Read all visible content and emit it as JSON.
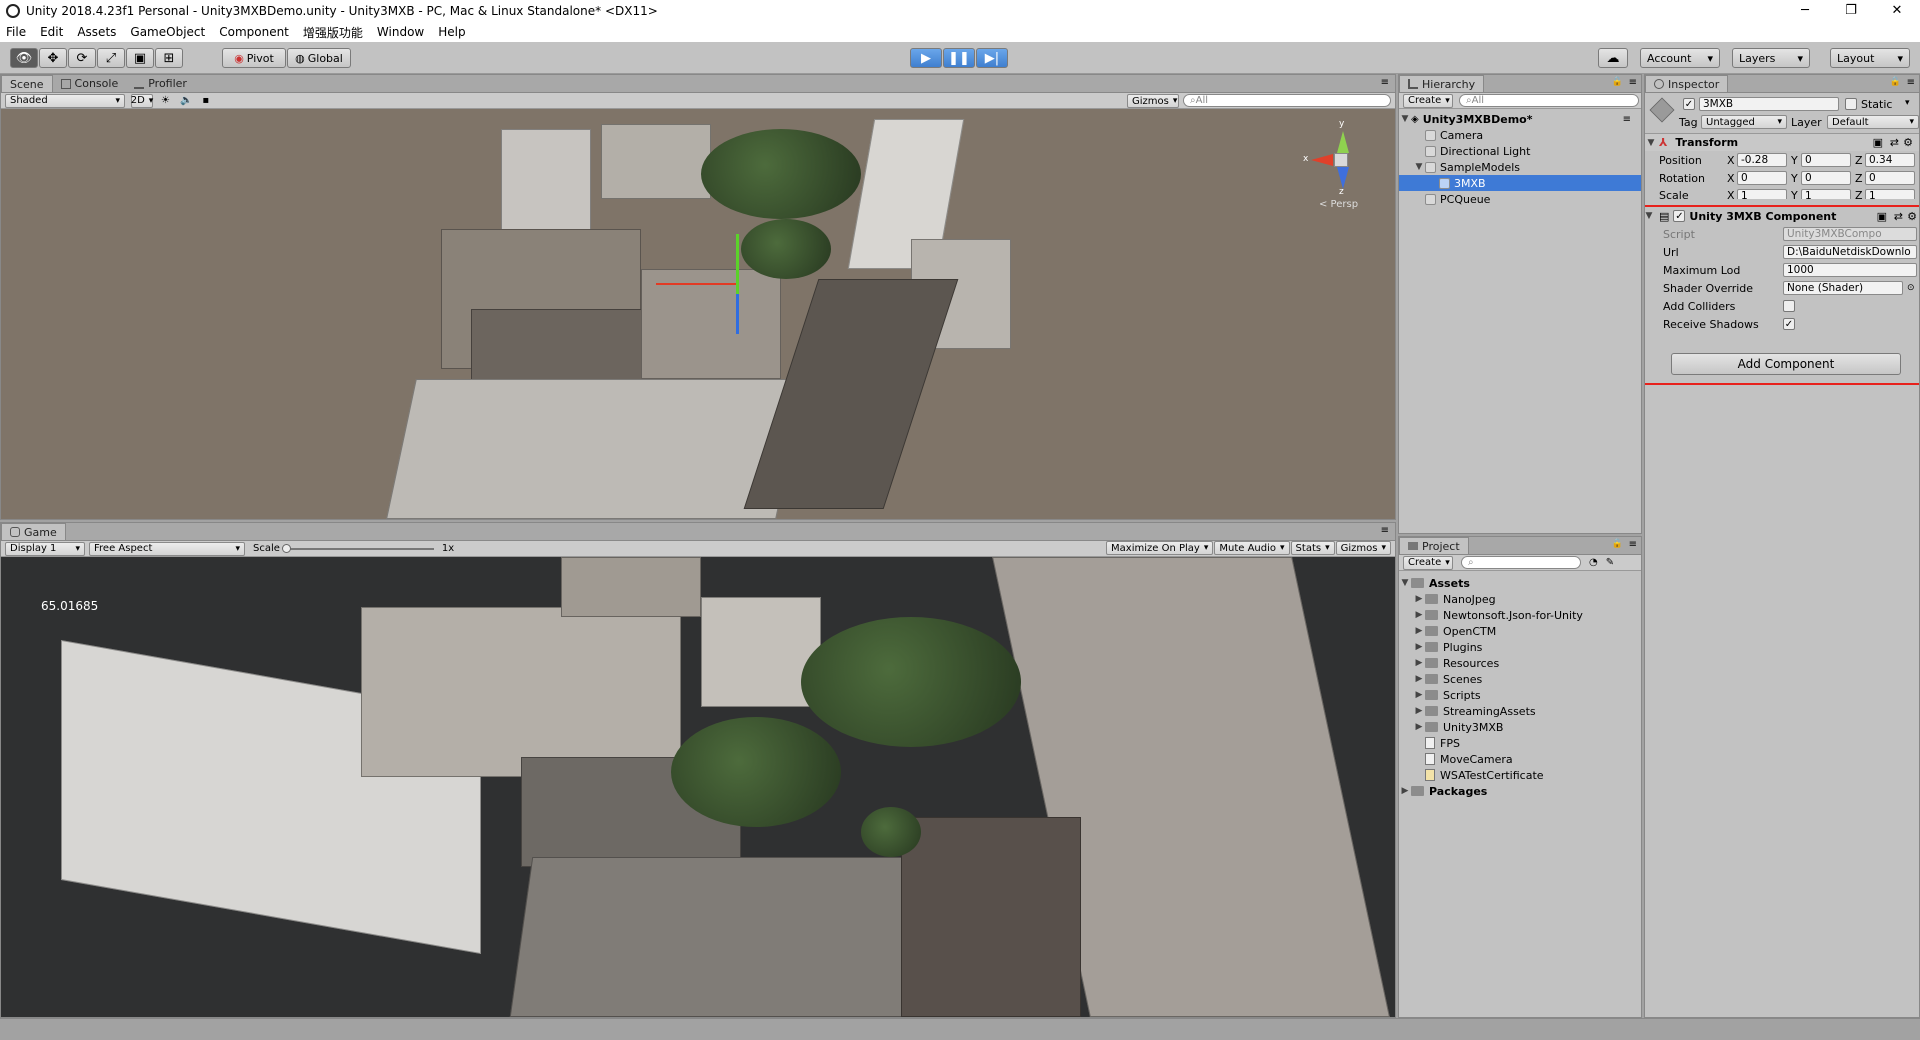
{
  "window": {
    "title": "Unity 2018.4.23f1 Personal - Unity3MXBDemo.unity - Unity3MXB - PC, Mac & Linux Standalone* <DX11>",
    "min": "─",
    "max": "❐",
    "close": "✕"
  },
  "menu": [
    "File",
    "Edit",
    "Assets",
    "GameObject",
    "Component",
    "增强版功能",
    "Window",
    "Help"
  ],
  "toolbar": {
    "pivot": "Pivot",
    "global": "Global",
    "account": "Account",
    "layers": "Layers",
    "layout": "Layout"
  },
  "scene": {
    "tabs": [
      "Scene",
      "Console",
      "Profiler"
    ],
    "shading": "Shaded",
    "mode2d": "2D",
    "gizmos": "Gizmos",
    "search_placeholder": "All",
    "persp": "< Persp",
    "axis_x": "x",
    "axis_y": "y",
    "axis_z": "z"
  },
  "game": {
    "tab": "Game",
    "display": "Display 1",
    "aspect": "Free Aspect",
    "scale_label": "Scale",
    "scale_value": "1x",
    "maximize": "Maximize On Play",
    "mute": "Mute Audio",
    "stats": "Stats",
    "gizmos": "Gizmos",
    "fps_readout": "65.01685"
  },
  "hierarchy": {
    "tab": "Hierarchy",
    "create": "Create",
    "search_placeholder": "All",
    "scene_name": "Unity3MXBDemo*",
    "items": [
      "Camera",
      "Directional Light",
      "SampleModels",
      "3MXB",
      "PCQueue"
    ]
  },
  "project": {
    "tab": "Project",
    "create": "Create",
    "root": "Assets",
    "folders": [
      "NanoJpeg",
      "Newtonsoft.Json-for-Unity",
      "OpenCTM",
      "Plugins",
      "Resources",
      "Scenes",
      "Scripts",
      "StreamingAssets",
      "Unity3MXB"
    ],
    "files": [
      "FPS",
      "MoveCamera",
      "WSATestCertificate"
    ],
    "packages": "Packages"
  },
  "inspector": {
    "tab": "Inspector",
    "object_name": "3MXB",
    "static_label": "Static",
    "tag_label": "Tag",
    "tag_value": "Untagged",
    "layer_label": "Layer",
    "layer_value": "Default",
    "transform": {
      "title": "Transform",
      "position_label": "Position",
      "rotation_label": "Rotation",
      "scale_label": "Scale",
      "position": [
        "-0.28",
        "0",
        "0.34"
      ],
      "rotation": [
        "0",
        "0",
        "0"
      ],
      "scale": [
        "1",
        "1",
        "1"
      ]
    },
    "component": {
      "title": "Unity 3MXB Component",
      "script_label": "Script",
      "script_value": "Unity3MXBCompo",
      "url_label": "Url",
      "url_value": "D:\\BaiduNetdiskDownlo",
      "maxlod_label": "Maximum Lod",
      "maxlod_value": "1000",
      "shader_label": "Shader Override",
      "shader_value": "None (Shader)",
      "colliders_label": "Add Colliders",
      "colliders_checked": false,
      "shadows_label": "Receive Shadows",
      "shadows_checked": true
    },
    "add_component": "Add Component",
    "highlight_color": "#e8211c"
  }
}
